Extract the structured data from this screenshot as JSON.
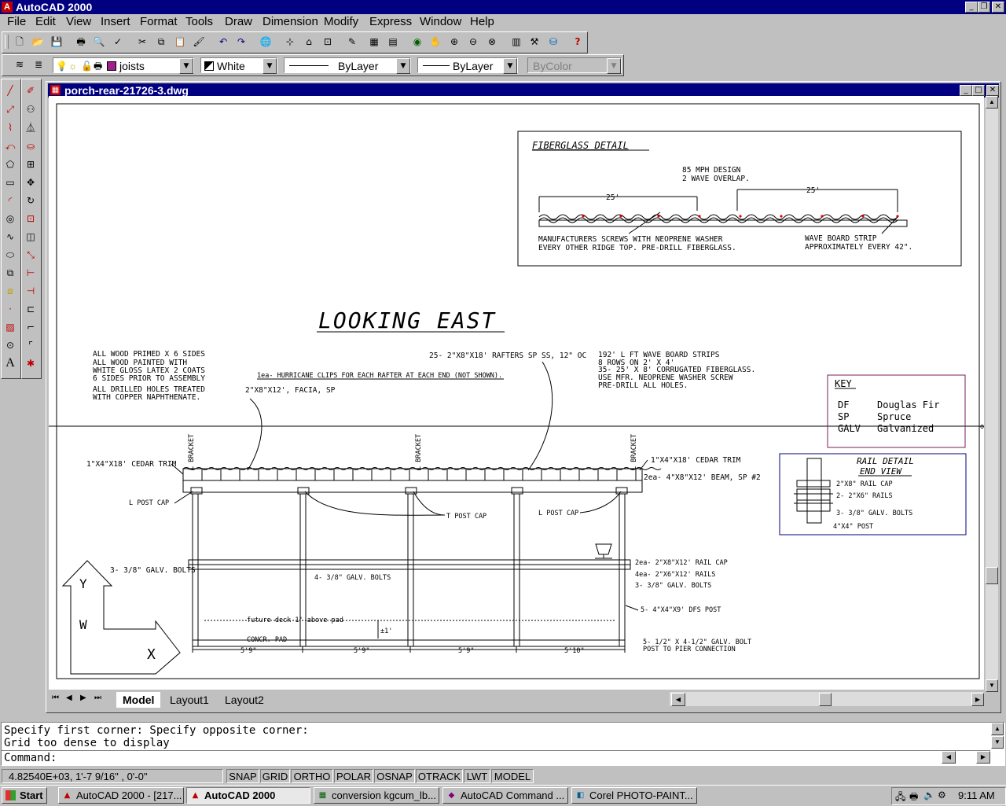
{
  "app": {
    "title": "AutoCAD 2000"
  },
  "menu": [
    "File",
    "Edit",
    "View",
    "Insert",
    "Format",
    "Tools",
    "Draw",
    "Dimension",
    "Modify",
    "Express",
    "Window",
    "Help"
  ],
  "properties_bar": {
    "layer": "joists",
    "color": "White",
    "linetype": "ByLayer",
    "lineweight": "ByLayer",
    "plotstyle": "ByColor"
  },
  "drawing_window": {
    "title": "porch-rear-21726-3.dwg"
  },
  "drawing": {
    "view_title": "LOOKING EAST",
    "fiberglass": {
      "title": "FIBERGLASS DETAIL",
      "design": "85 MPH DESIGN",
      "overlap": "2 WAVE OVERLAP.",
      "dim1": "25'",
      "dim2": "25'",
      "screws_1": "MANUFACTURERS SCREWS WITH NEOPRENE WASHER",
      "screws_2": "EVERY OTHER RIDGE TOP.  PRE-DRILL FIBERGLASS.",
      "strip_1": "WAVE BOARD STRIP",
      "strip_2": "APPROXIMATELY EVERY 42\"."
    },
    "notes_left": [
      "ALL WOOD PRIMED X 6 SIDES",
      "ALL WOOD PAINTED WITH",
      "WHITE GLOSS LATEX 2 COATS",
      "6 SIDES PRIOR TO ASSEMBLY",
      "ALL DRILLED HOLES TREATED",
      "WITH COPPER NAPHTHENATE."
    ],
    "rafters": "25- 2\"X8\"X18' RAFTERS SP SS, 12\" OC",
    "hurricane": "1ea- HURRICANE CLIPS FOR EACH RAFTER AT EACH END (NOT SHOWN).",
    "facia": "2\"X8\"X12', FACIA, SP",
    "notes_right": [
      "192' L FT WAVE BOARD STRIPS",
      "8 ROWS ON 2' X 4'",
      "35- 25' X 8' CORRUGATED FIBERGLASS.",
      "USE MFR. NEOPRENE WASHER SCREW",
      "PRE-DRILL ALL HOLES."
    ],
    "key": {
      "title": "KEY",
      "rows": [
        [
          "DF",
          "Douglas Fir"
        ],
        [
          "SP",
          "Spruce"
        ],
        [
          "GALV",
          "Galvanized"
        ]
      ]
    },
    "rail_detail": {
      "title_1": "RAIL DETAIL",
      "title_2": "END VIEW",
      "cap": "2\"X8\" RAIL CAP",
      "rails": "2- 2\"X6\" RAILS",
      "bolts": "3- 3/8\" GALV. BOLTS",
      "post": "4\"X4\" POST"
    },
    "bracket": "L BRACKET",
    "cedar_left": "1\"X4\"X18' CEDAR TRIM",
    "cedar_right": "1\"X4\"X18' CEDAR TRIM",
    "beam": "2ea- 4\"X8\"X12' BEAM, SP #2",
    "l_post_cap_left": "L POST CAP",
    "t_post_cap": "T POST CAP",
    "l_post_cap_right": "L POST CAP",
    "bolts_left": "3- 3/8\" GALV. BOLTS",
    "bolts_mid": "4- 3/8\" GALV. BOLTS",
    "rail_cap": "2ea- 2\"X8\"X12' RAIL CAP",
    "rails": "4ea- 2\"X6\"X12' RAILS",
    "rail_bolts": "3- 3/8\" GALV. BOLTS",
    "post": "5- 4\"X4\"X9' DFS POST",
    "future_deck": "future deck 1' above pad",
    "plus_minus": "±1'",
    "concrete": "CONCR. PAD",
    "pier_1": "5- 1/2\" X 4-1/2\" GALV. BOLT",
    "pier_2": "POST TO PIER CONNECTION",
    "dims": [
      "5'9\"",
      "5'9\"",
      "5'9\"",
      "5'10\""
    ],
    "ucs": {
      "y": "Y",
      "w": "W",
      "x": "X"
    }
  },
  "tabs": [
    "Model",
    "Layout1",
    "Layout2"
  ],
  "command": {
    "line1": "Specify first corner: Specify opposite corner:",
    "line2": "Grid too dense to display",
    "prompt": "Command:"
  },
  "status": {
    "coords": "4.82540E+03, 1'-7 9/16\" , 0'-0\"",
    "toggles": [
      "SNAP",
      "GRID",
      "ORTHO",
      "POLAR",
      "OSNAP",
      "OTRACK",
      "LWT",
      "MODEL"
    ]
  },
  "taskbar": {
    "start": "Start",
    "tasks": [
      "AutoCAD 2000 - [217...",
      "AutoCAD 2000",
      "conversion kgcum_lb...",
      "AutoCAD Command ...",
      "Corel PHOTO-PAINT..."
    ],
    "clock": "9:11 AM"
  }
}
